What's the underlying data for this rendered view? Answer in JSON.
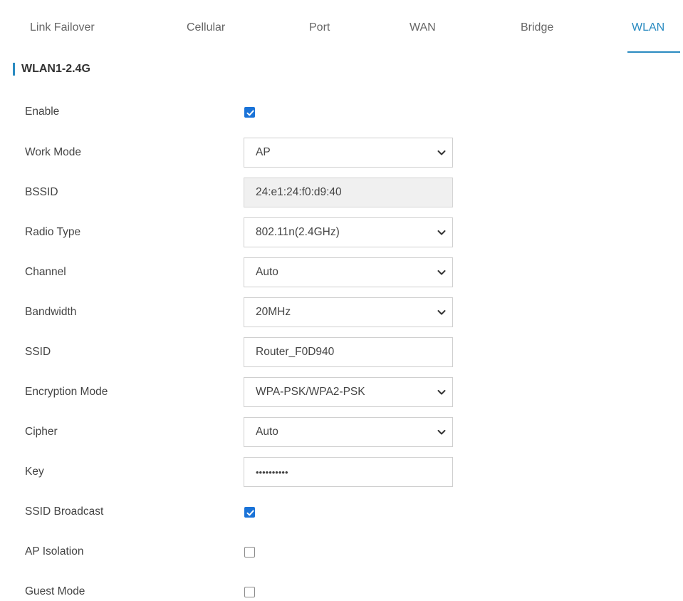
{
  "tabs": [
    {
      "label": "Link Failover"
    },
    {
      "label": "Cellular"
    },
    {
      "label": "Port"
    },
    {
      "label": "WAN"
    },
    {
      "label": "Bridge"
    },
    {
      "label": "WLAN",
      "active": true
    }
  ],
  "section": {
    "title": "WLAN1-2.4G"
  },
  "form": {
    "enable": {
      "label": "Enable",
      "checked": true
    },
    "work_mode": {
      "label": "Work Mode",
      "value": "AP"
    },
    "bssid": {
      "label": "BSSID",
      "value": "24:e1:24:f0:d9:40"
    },
    "radio_type": {
      "label": "Radio Type",
      "value": "802.11n(2.4GHz)"
    },
    "channel": {
      "label": "Channel",
      "value": "Auto"
    },
    "bandwidth": {
      "label": "Bandwidth",
      "value": "20MHz"
    },
    "ssid": {
      "label": "SSID",
      "value": "Router_F0D940"
    },
    "encryption_mode": {
      "label": "Encryption Mode",
      "value": "WPA-PSK/WPA2-PSK"
    },
    "cipher": {
      "label": "Cipher",
      "value": "Auto"
    },
    "key": {
      "label": "Key",
      "value": "••••••••••"
    },
    "ssid_broadcast": {
      "label": "SSID Broadcast",
      "checked": true
    },
    "ap_isolation": {
      "label": "AP Isolation",
      "checked": false
    },
    "guest_mode": {
      "label": "Guest Mode",
      "checked": false
    }
  },
  "colors": {
    "accent": "#2a8bc1",
    "checkbox_checked": "#1a73d8"
  },
  "icons": {
    "dropdown": "chevron-down-icon",
    "checkmark": "checkmark-icon"
  }
}
